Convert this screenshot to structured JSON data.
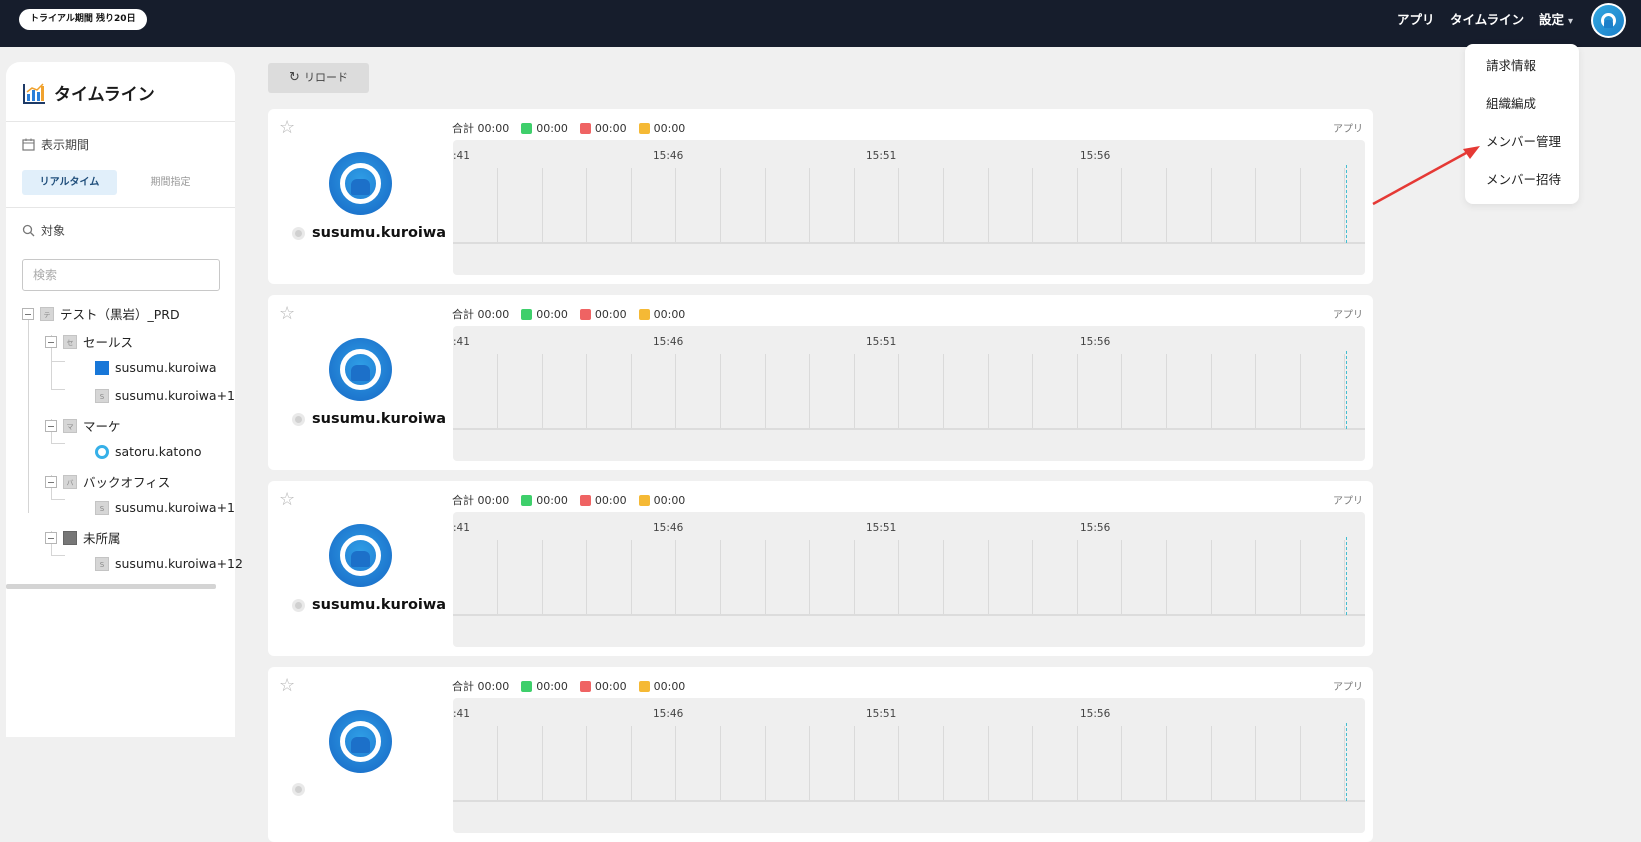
{
  "topbar": {
    "trial_badge": "トライアル期間 残り20日",
    "nav": [
      "アプリ",
      "タイムライン"
    ],
    "settings_label": "設定"
  },
  "settings_menu": {
    "items": [
      "請求情報",
      "組織編成",
      "メンバー管理",
      "メンバー招待"
    ]
  },
  "sidebar": {
    "title": "タイムライン",
    "period_label": "表示期間",
    "period_options": [
      "リアルタイム",
      "期間指定"
    ],
    "period_selected": "リアルタイム",
    "target_label": "対象",
    "search_placeholder": "検索",
    "tree": {
      "root": {
        "badge": "テ",
        "label": "テスト（黒岩）_PRD"
      },
      "groups": [
        {
          "badge": "セ",
          "label": "セールス",
          "members": [
            {
              "badge": "blue",
              "label": "susumu.kuroiwa"
            },
            {
              "badge": "S",
              "label": "susumu.kuroiwa+1"
            }
          ]
        },
        {
          "badge": "マ",
          "label": "マーケ",
          "members": [
            {
              "badge": "ring",
              "label": "satoru.katono"
            }
          ]
        },
        {
          "badge": "バ",
          "label": "バックオフィス",
          "members": [
            {
              "badge": "S",
              "label": "susumu.kuroiwa+1"
            }
          ]
        },
        {
          "badge": "person",
          "label": "未所属",
          "members": [
            {
              "badge": "S",
              "label": "susumu.kuroiwa+12"
            }
          ]
        }
      ]
    }
  },
  "reload_label": "リロード",
  "timeline": {
    "stats": {
      "total_label": "合計",
      "total": "00:00",
      "green": "00:00",
      "red": "00:00",
      "yellow": "00:00"
    },
    "app_link": "アプリ",
    "ticks": [
      ":41",
      "15:46",
      "15:51",
      "15:56"
    ],
    "cards": [
      {
        "user": "susumu.kuroiwa"
      },
      {
        "user": "susumu.kuroiwa"
      },
      {
        "user": "susumu.kuroiwa"
      },
      {
        "user": ""
      }
    ]
  },
  "colors": {
    "topbar": "#161d2c",
    "green": "#3ecf6b",
    "red": "#ef6363",
    "yellow": "#f5b935",
    "annotation_arrow": "#e53935"
  }
}
